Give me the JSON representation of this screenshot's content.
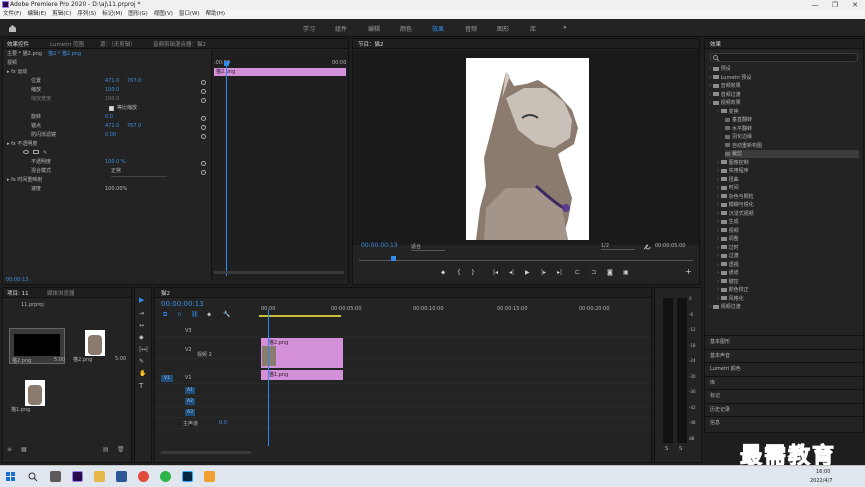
{
  "window": {
    "title": "Adobe Premiere Pro 2020 - D:\\aj\\11.prproj *",
    "min": "—",
    "max": "❐",
    "close": "✕"
  },
  "menu": [
    "文件(F)",
    "编辑(E)",
    "剪辑(C)",
    "序列(S)",
    "标记(M)",
    "图形(G)",
    "视图(V)",
    "窗口(W)",
    "帮助(H)"
  ],
  "workspaces": {
    "items": [
      "学习",
      "组件",
      "编辑",
      "颜色",
      "效果",
      "音频",
      "图形",
      "库"
    ],
    "active_index": 4,
    "more": "»"
  },
  "effect_controls": {
    "tabs": [
      "效果控件",
      "Lumetri 范围",
      "源：（无剪辑）",
      "音频剪辑混合器：猫2"
    ],
    "master": "主要 * 猫2.png",
    "seq": "猫2 * 猫2.png",
    "time_start": ":00:00",
    "time_end": "00:00",
    "clip_label": "猫2.png",
    "section_video": "视频",
    "motion": "运动",
    "rows": [
      {
        "name": "位置",
        "v1": "471.0",
        "v2": "767.0"
      },
      {
        "name": "缩放",
        "v1": "100.0",
        "v2": ""
      },
      {
        "name": "缩放宽度",
        "v1": "100.0",
        "v2": ""
      },
      {
        "name": "等比缩放",
        "v1": "",
        "v2": ""
      },
      {
        "name": "旋转",
        "v1": "0.0",
        "v2": ""
      },
      {
        "name": "锚点",
        "v1": "471.0",
        "v2": "767.0"
      },
      {
        "name": "防闪烁滤镜",
        "v1": "0.00",
        "v2": ""
      }
    ],
    "opacity": "不透明度",
    "opacity_row": {
      "name": "不透明度",
      "v1": "100.0 %"
    },
    "blend_row": {
      "name": "混合模式",
      "v1": "正常"
    },
    "timeremap": "时间重映射",
    "speed_row": {
      "name": "速度",
      "v1": "100.00%"
    },
    "timecode": "00:00:13"
  },
  "program": {
    "title": "节目：猫2",
    "timecode": "00:00:00:13",
    "fit": "适合",
    "ratio": "1/2",
    "duration": "00:00:05:00"
  },
  "project": {
    "tabs": [
      "项目: 11",
      "媒体浏览器"
    ],
    "file": "11.prproj",
    "items": [
      {
        "name": "猫2.png",
        "dur": "5:00"
      },
      {
        "name": "猫2.png",
        "dur": "5:00"
      },
      {
        "name": "猫1.png",
        "dur": ""
      }
    ]
  },
  "timeline": {
    "tab": "猫2",
    "timecode": "00:00:00:13",
    "ruler": [
      "00:00",
      "00:00:05:00",
      "00:00:10:00",
      "00:00:15:00",
      "00:00:20:00"
    ],
    "tracks": [
      "V3",
      "V2",
      "V1",
      "A1",
      "A2",
      "A3"
    ],
    "video2": "视频 2",
    "master": "主声道",
    "master_val": "0.0",
    "clip_top": "猫2.png",
    "clip_bottom": "猫1.png"
  },
  "meter": {
    "labels": [
      "0",
      "-6",
      "-12",
      "-18",
      "-24",
      "-30",
      "-36",
      "-42",
      "-48",
      "dB"
    ],
    "bottom": [
      "S",
      "S"
    ]
  },
  "effects": {
    "title": "效果",
    "tree": [
      {
        "label": "预设",
        "depth": 0
      },
      {
        "label": "Lumetri 预设",
        "depth": 0
      },
      {
        "label": "音频效果",
        "depth": 0
      },
      {
        "label": "音频过渡",
        "depth": 0
      },
      {
        "label": "视频效果",
        "depth": 0
      },
      {
        "label": "变换",
        "depth": 1
      },
      {
        "label": "垂直翻转",
        "depth": 2
      },
      {
        "label": "水平翻转",
        "depth": 2
      },
      {
        "label": "羽化边缘",
        "depth": 2
      },
      {
        "label": "自动重新构图",
        "depth": 2
      },
      {
        "label": "裁剪",
        "depth": 2,
        "selected": true
      },
      {
        "label": "图像控制",
        "depth": 1
      },
      {
        "label": "实用程序",
        "depth": 1
      },
      {
        "label": "扭曲",
        "depth": 1
      },
      {
        "label": "时间",
        "depth": 1
      },
      {
        "label": "杂色与颗粒",
        "depth": 1
      },
      {
        "label": "模糊与锐化",
        "depth": 1
      },
      {
        "label": "沉浸式视频",
        "depth": 1
      },
      {
        "label": "生成",
        "depth": 1
      },
      {
        "label": "视频",
        "depth": 1
      },
      {
        "label": "调整",
        "depth": 1
      },
      {
        "label": "过时",
        "depth": 1
      },
      {
        "label": "过渡",
        "depth": 1
      },
      {
        "label": "透视",
        "depth": 1
      },
      {
        "label": "通道",
        "depth": 1
      },
      {
        "label": "键控",
        "depth": 1
      },
      {
        "label": "颜色校正",
        "depth": 1
      },
      {
        "label": "风格化",
        "depth": 1
      },
      {
        "label": "视频过渡",
        "depth": 0
      }
    ],
    "sections": [
      "基本图形",
      "基本声音",
      "Lumetri 颜色",
      "库",
      "标记",
      "历史记录",
      "信息"
    ]
  },
  "taskbar": {
    "time": "16:00",
    "date": "2022/4/7"
  },
  "watermark": "最需教育",
  "colors": {
    "accent": "#2d8ceb",
    "clip": "#d48fd9",
    "selected": "#3c3c3c"
  }
}
